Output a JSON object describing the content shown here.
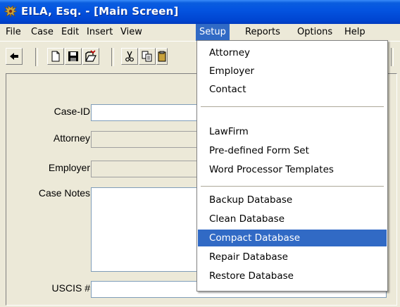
{
  "window": {
    "title": "EILA, Esq. - [Main Screen]"
  },
  "menubar": {
    "items": [
      "File",
      "Case",
      "Edit",
      "Insert",
      "View",
      "Setup",
      "Reports",
      "Options",
      "Help"
    ],
    "active": "Setup"
  },
  "toolbar": {
    "buttons": [
      "back-arrow-icon",
      "new-document-icon",
      "save-icon",
      "open-folder-icon",
      "cut-icon",
      "copy-icon",
      "paste-icon"
    ]
  },
  "form": {
    "case_id_label": "Case-ID",
    "attorney_label": "Attorney",
    "employer_label": "Employer",
    "case_notes_label": "Case Notes",
    "uscis_label": "USCIS #"
  },
  "setup_menu": {
    "groups": [
      [
        "Attorney",
        "Employer",
        "Contact"
      ],
      [
        "LawFirm",
        "Pre-defined Form Set",
        "Word Processor Templates"
      ],
      [
        "Backup Database",
        "Clean Database",
        "Compact Database",
        "Repair Database",
        "Restore Database"
      ]
    ],
    "highlighted": "Compact Database"
  },
  "colors": {
    "title_bar": "#0a5ddf",
    "menu_highlight": "#316ac5",
    "window_face": "#ece9d8"
  }
}
